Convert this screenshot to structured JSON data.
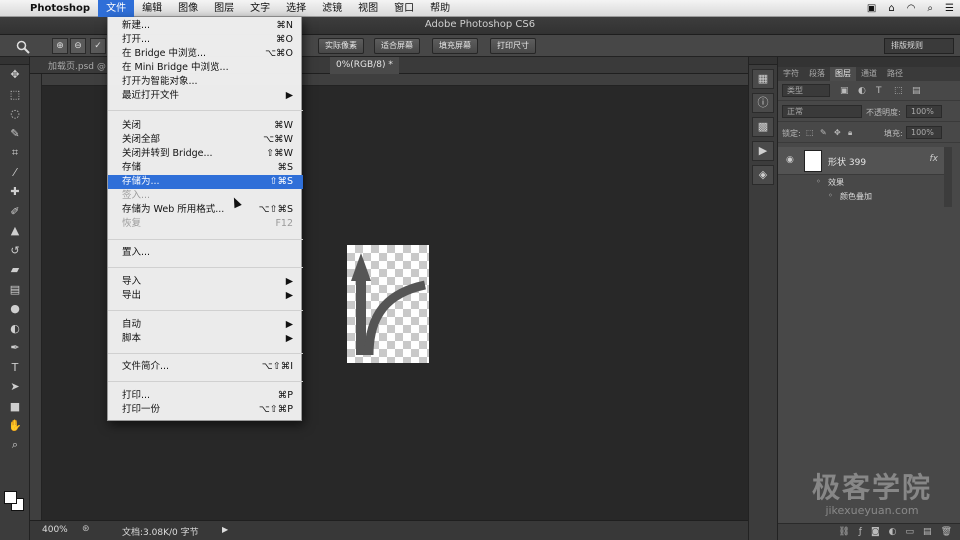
{
  "menubar": {
    "apple_icon": "apple-icon",
    "app_name": "Photoshop",
    "items": [
      "文件",
      "编辑",
      "图像",
      "图层",
      "文字",
      "选择",
      "滤镜",
      "视图",
      "窗口",
      "帮助"
    ],
    "active_item": "文件"
  },
  "window": {
    "title": "Adobe Photoshop CS6"
  },
  "options": {
    "buttons": [
      "实际像素",
      "适合屏幕",
      "填充屏幕",
      "打印尺寸"
    ],
    "workspace": "排版规则"
  },
  "document": {
    "tab_inactive": "加载页.psd @",
    "tab_active_suffix": "0%(RGB/8) *",
    "zoom": "400%",
    "info": "文档:3.08K/0 字节"
  },
  "file_menu": {
    "items": [
      {
        "label": "新建...",
        "shortcut": "⌘N",
        "enabled": true
      },
      {
        "label": "打开...",
        "shortcut": "⌘O",
        "enabled": true
      },
      {
        "label": "在 Bridge 中浏览...",
        "shortcut": "⌥⌘O",
        "enabled": true
      },
      {
        "label": "在 Mini Bridge 中浏览...",
        "shortcut": "",
        "enabled": true
      },
      {
        "label": "打开为智能对象...",
        "shortcut": "",
        "enabled": true
      },
      {
        "label": "最近打开文件",
        "shortcut": "▶",
        "enabled": true
      },
      {
        "label": "关闭",
        "shortcut": "⌘W",
        "enabled": true
      },
      {
        "label": "关闭全部",
        "shortcut": "⌥⌘W",
        "enabled": true
      },
      {
        "label": "关闭并转到 Bridge...",
        "shortcut": "⇧⌘W",
        "enabled": true
      },
      {
        "label": "存储",
        "shortcut": "⌘S",
        "enabled": true
      },
      {
        "label": "存储为...",
        "shortcut": "⇧⌘S",
        "enabled": true,
        "selected": true
      },
      {
        "label": "签入...",
        "shortcut": "",
        "enabled": false
      },
      {
        "label": "存储为 Web 所用格式...",
        "shortcut": "⌥⇧⌘S",
        "enabled": true
      },
      {
        "label": "恢复",
        "shortcut": "F12",
        "enabled": false
      },
      {
        "label": "置入...",
        "shortcut": "",
        "enabled": true
      },
      {
        "label": "导入",
        "shortcut": "▶",
        "enabled": true
      },
      {
        "label": "导出",
        "shortcut": "▶",
        "enabled": true
      },
      {
        "label": "自动",
        "shortcut": "▶",
        "enabled": true
      },
      {
        "label": "脚本",
        "shortcut": "▶",
        "enabled": true
      },
      {
        "label": "文件简介...",
        "shortcut": "⌥⇧⌘I",
        "enabled": true
      },
      {
        "label": "打印...",
        "shortcut": "⌘P",
        "enabled": true
      },
      {
        "label": "打印一份",
        "shortcut": "⌥⇧⌘P",
        "enabled": true
      }
    ]
  },
  "layers_panel": {
    "tabs": [
      "字符",
      "段落",
      "图层",
      "通道",
      "路径"
    ],
    "active_tab": "图层",
    "filter": "类型",
    "blend_mode": "正常",
    "opacity_label": "不透明度:",
    "opacity": "100%",
    "lock_label": "锁定:",
    "fill_label": "填充:",
    "fill": "100%",
    "layer_name": "形状 399",
    "fx": "fx",
    "effects_label": "效果",
    "effect_item": "颜色叠加"
  },
  "watermark": {
    "line1": "极客学院",
    "line2": "jikexueyuan.com"
  }
}
